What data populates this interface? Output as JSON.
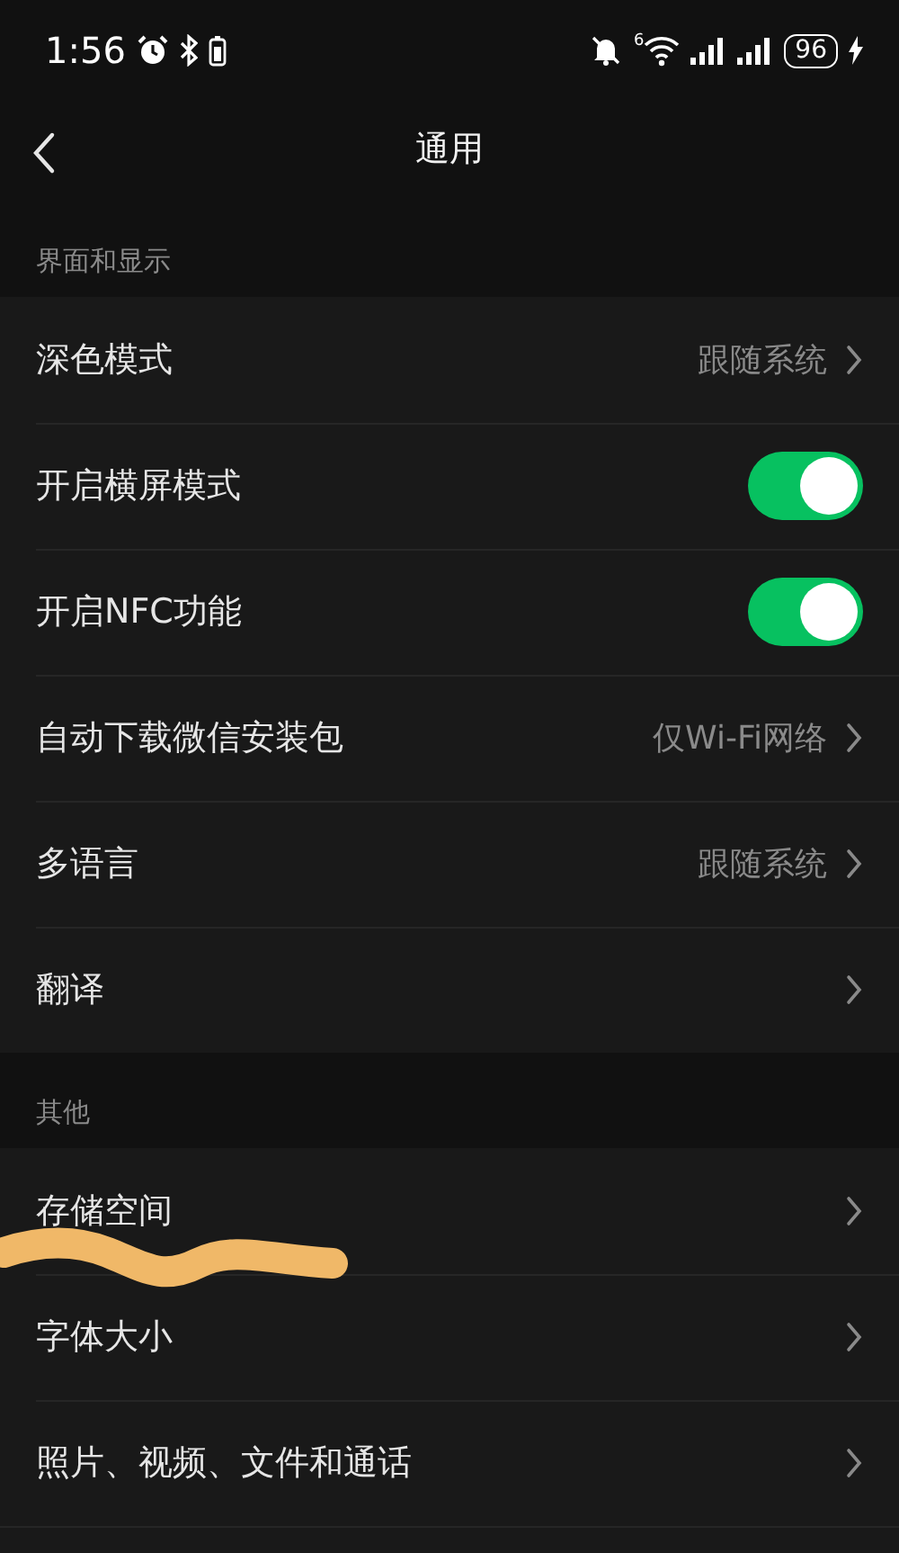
{
  "status_bar": {
    "time": "1:56",
    "wifi_badge": "6",
    "battery": "96"
  },
  "header": {
    "title": "通用"
  },
  "sections": [
    {
      "title": "界面和显示",
      "rows": [
        {
          "kind": "value",
          "label": "深色模式",
          "value": "跟随系统"
        },
        {
          "kind": "toggle",
          "label": "开启横屏模式",
          "on": true
        },
        {
          "kind": "toggle",
          "label": "开启NFC功能",
          "on": true
        },
        {
          "kind": "value",
          "label": "自动下载微信安装包",
          "value": "仅Wi-Fi网络"
        },
        {
          "kind": "value",
          "label": "多语言",
          "value": "跟随系统"
        },
        {
          "kind": "link",
          "label": "翻译"
        }
      ]
    },
    {
      "title": "其他",
      "rows": [
        {
          "kind": "link",
          "label": "存储空间"
        },
        {
          "kind": "link",
          "label": "字体大小"
        },
        {
          "kind": "link",
          "label": "照片、视频、文件和通话"
        }
      ]
    }
  ]
}
